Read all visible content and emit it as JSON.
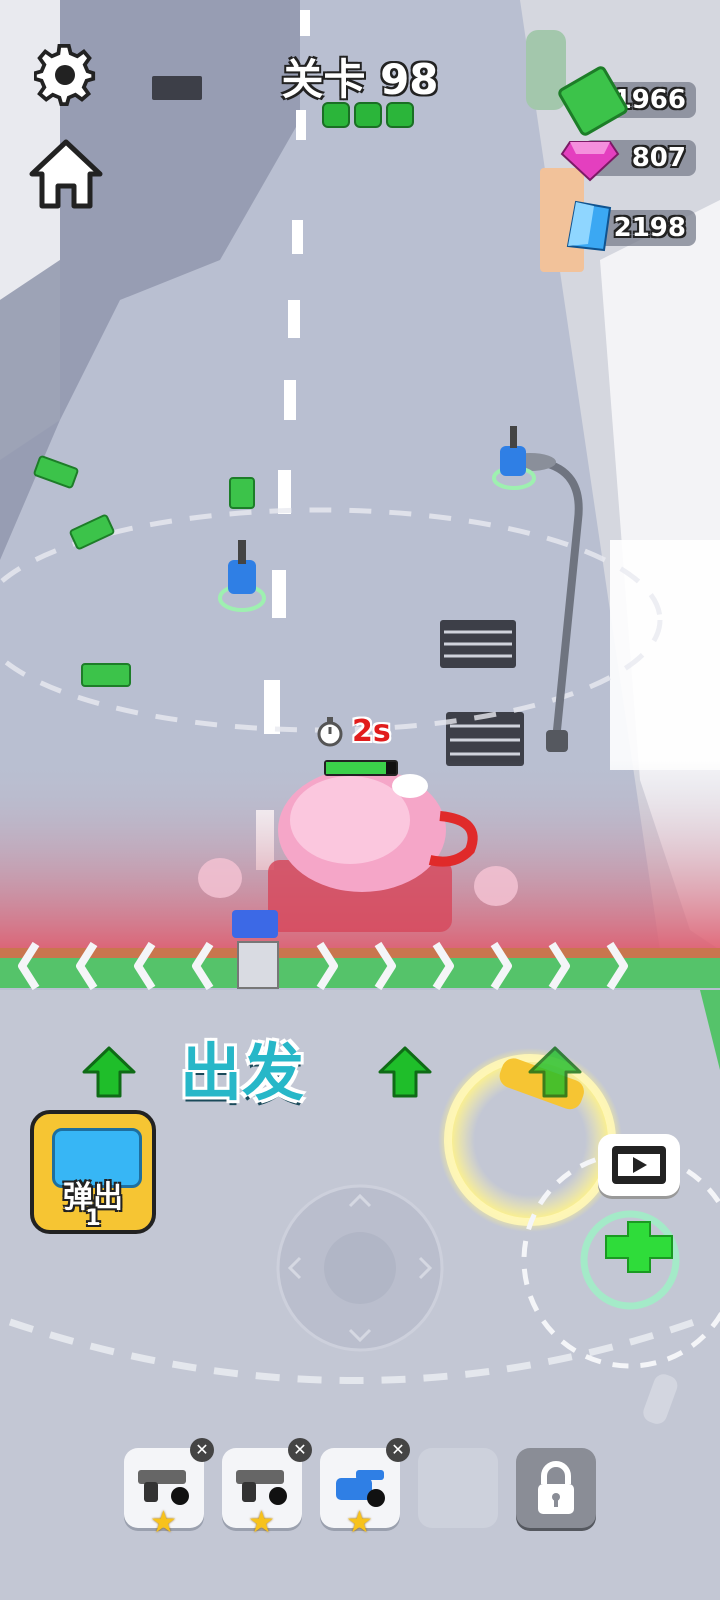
{
  "level": {
    "label": "关卡 98",
    "progress_total": 3,
    "progress_filled": 3
  },
  "currencies": [
    {
      "name": "cash",
      "value": "1966",
      "icon": "cash-icon",
      "color": "#3cc34a"
    },
    {
      "name": "gem",
      "value": "807",
      "icon": "pink-gem-icon",
      "color": "#e43fbf"
    },
    {
      "name": "crystal",
      "value": "2198",
      "icon": "blue-crystal-icon",
      "color": "#3ba8f3"
    }
  ],
  "boss": {
    "timer_label": "2s",
    "health_fraction": 0.85
  },
  "go_label": "出发",
  "eject_card": {
    "label": "弹出",
    "count": "1"
  },
  "inventory": [
    {
      "icon": "pistol-icon",
      "stars": 1,
      "closable": true
    },
    {
      "icon": "pistol-icon",
      "stars": 1,
      "closable": true
    },
    {
      "icon": "blue-cannon-icon",
      "stars": 1,
      "closable": true
    },
    {
      "icon": "empty-slot",
      "stars": 0,
      "closable": false
    },
    {
      "icon": "lock-icon",
      "stars": 0,
      "closable": false
    }
  ],
  "colors": {
    "road": "#b9bfd1",
    "danger": "#e05a6c",
    "accent": "#1fbe2a",
    "level_pip": "#2bb53a"
  }
}
